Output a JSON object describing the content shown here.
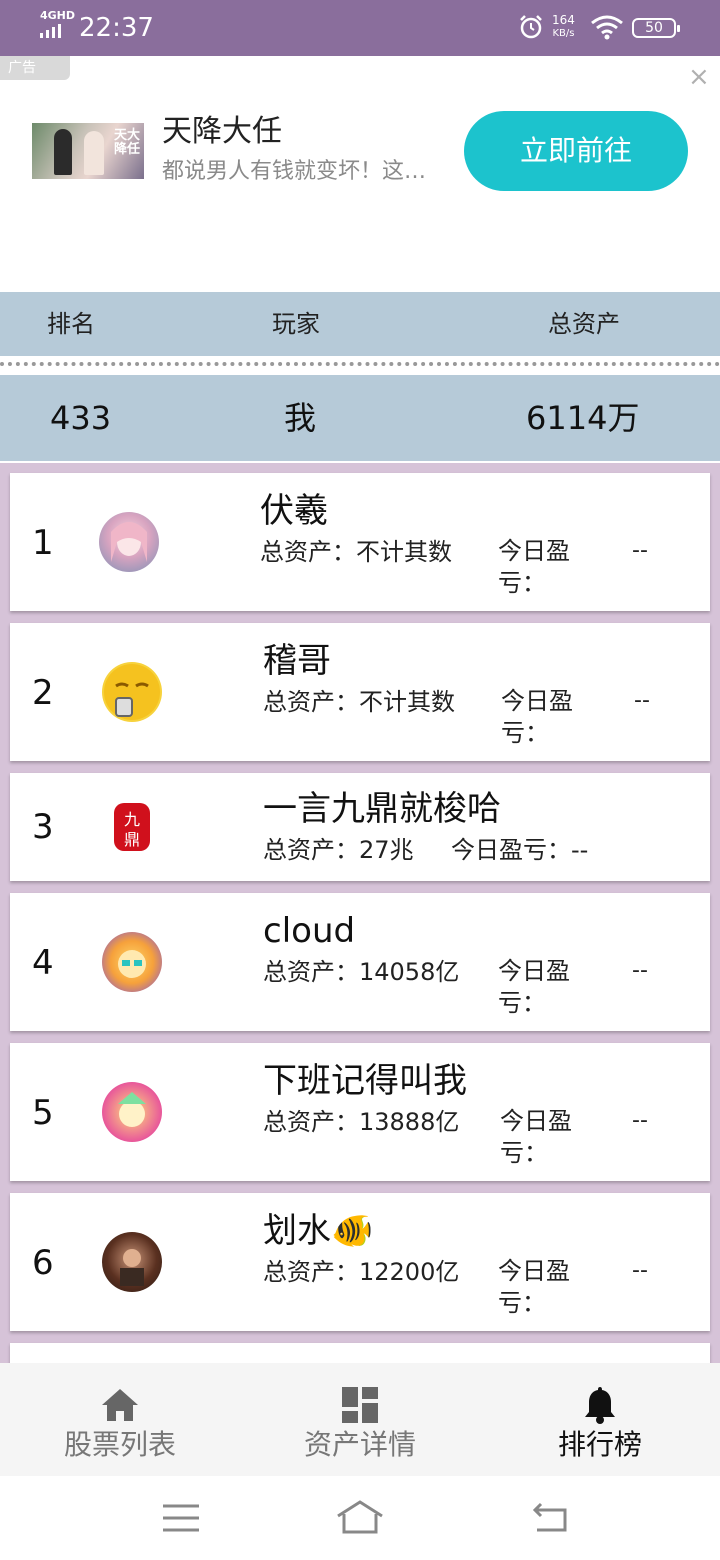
{
  "status_bar": {
    "network": "4GHD",
    "time": "22:37",
    "speed_value": "164",
    "speed_unit": "KB/s",
    "battery": "50"
  },
  "ad": {
    "tag": "广告",
    "close": "×",
    "title": "天降大任",
    "description": "都说男人有钱就变坏！这…",
    "button": "立即前往",
    "image_text": "天大降任"
  },
  "leaderboard": {
    "header": {
      "rank": "排名",
      "player": "玩家",
      "assets": "总资产"
    },
    "me": {
      "rank": "433",
      "name": "我",
      "assets": "6114万"
    },
    "entries": [
      {
        "rank": "1",
        "name": "伏羲",
        "total": "总资产：不计其数",
        "pl_label": "今日盈亏：",
        "pl_value": "--",
        "avatar": "anime-girl-pink"
      },
      {
        "rank": "2",
        "name": "稽哥",
        "total": "总资产：不计其数",
        "pl_label": "今日盈亏：",
        "pl_value": "--",
        "avatar": "yellow-emoji"
      },
      {
        "rank": "3",
        "name": "一言九鼎就梭哈",
        "total": "总资产：27兆",
        "pl_label": "今日盈亏：--",
        "pl_value": "",
        "avatar": "red-seal"
      },
      {
        "rank": "4",
        "name": "cloud",
        "total": "总资产：14058亿",
        "pl_label": "今日盈亏：",
        "pl_value": "--",
        "avatar": "anime-purple"
      },
      {
        "rank": "5",
        "name": "下班记得叫我",
        "total": "总资产：13888亿",
        "pl_label": "今日盈亏：",
        "pl_value": "--",
        "avatar": "anime-pink"
      },
      {
        "rank": "6",
        "name": "划水🐠",
        "total": "总资产：12200亿",
        "pl_label": "今日盈亏：",
        "pl_value": "--",
        "avatar": "photo-man"
      }
    ]
  },
  "bottom_nav": {
    "items": [
      {
        "label": "股票列表",
        "icon": "home-icon"
      },
      {
        "label": "资产详情",
        "icon": "dashboard-icon"
      },
      {
        "label": "排行榜",
        "icon": "bell-icon"
      }
    ],
    "active": "排行榜"
  },
  "system_nav": {
    "icons": [
      "menu-icon",
      "home-icon",
      "back-icon"
    ]
  },
  "colors": {
    "status_bar": "#8a6e9c",
    "header_bg": "#b6cad8",
    "list_bg": "#d6c3d8",
    "ad_button": "#1cc3cd"
  }
}
